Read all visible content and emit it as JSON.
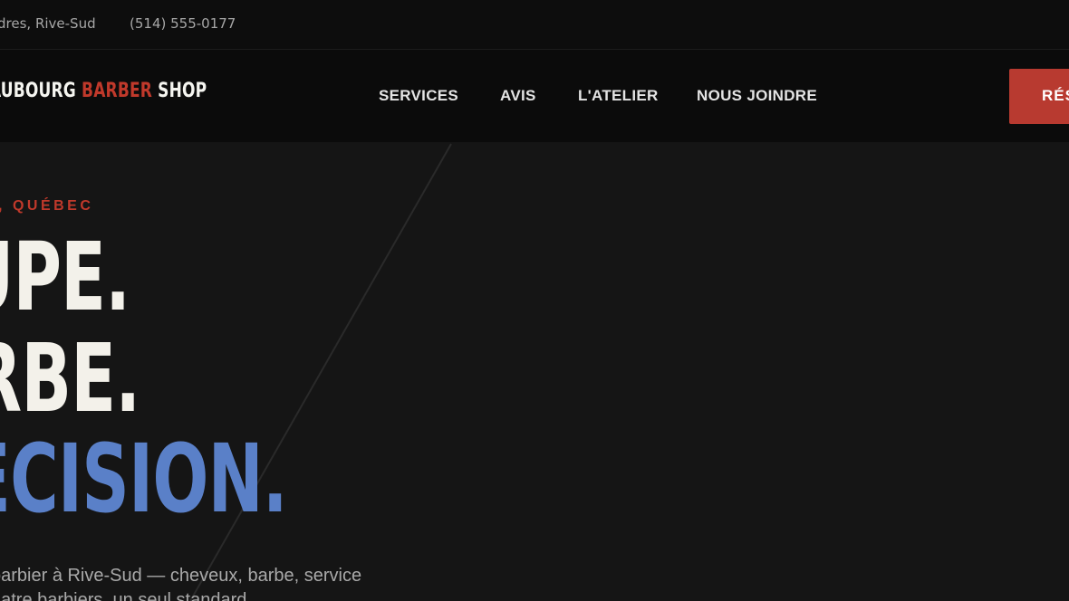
{
  "topbar": {
    "address": "dres, Rive-Sud",
    "phone": "(514) 555-0177"
  },
  "brand": {
    "part1": "AUBOURG ",
    "part2": "BARBER",
    "part3": " SHOP"
  },
  "nav": {
    "items": [
      {
        "label": "SERVICES"
      },
      {
        "label": "AVIS"
      },
      {
        "label": "L'ATELIER"
      },
      {
        "label": "NOUS JOINDRE"
      }
    ],
    "cta_label": "RÉS"
  },
  "hero": {
    "kicker": "D, QUÉBEC",
    "line1": "UPE.",
    "line2": "RBE.",
    "line3": "ÉCISION.",
    "lede_line1": "barbier à Rive-Sud — cheveux, barbe, service",
    "lede_line2": "uatre barbiers, un seul standard."
  },
  "colors": {
    "accent_red": "#c0392b",
    "accent_blue": "#5a80c8",
    "background": "#151515"
  }
}
